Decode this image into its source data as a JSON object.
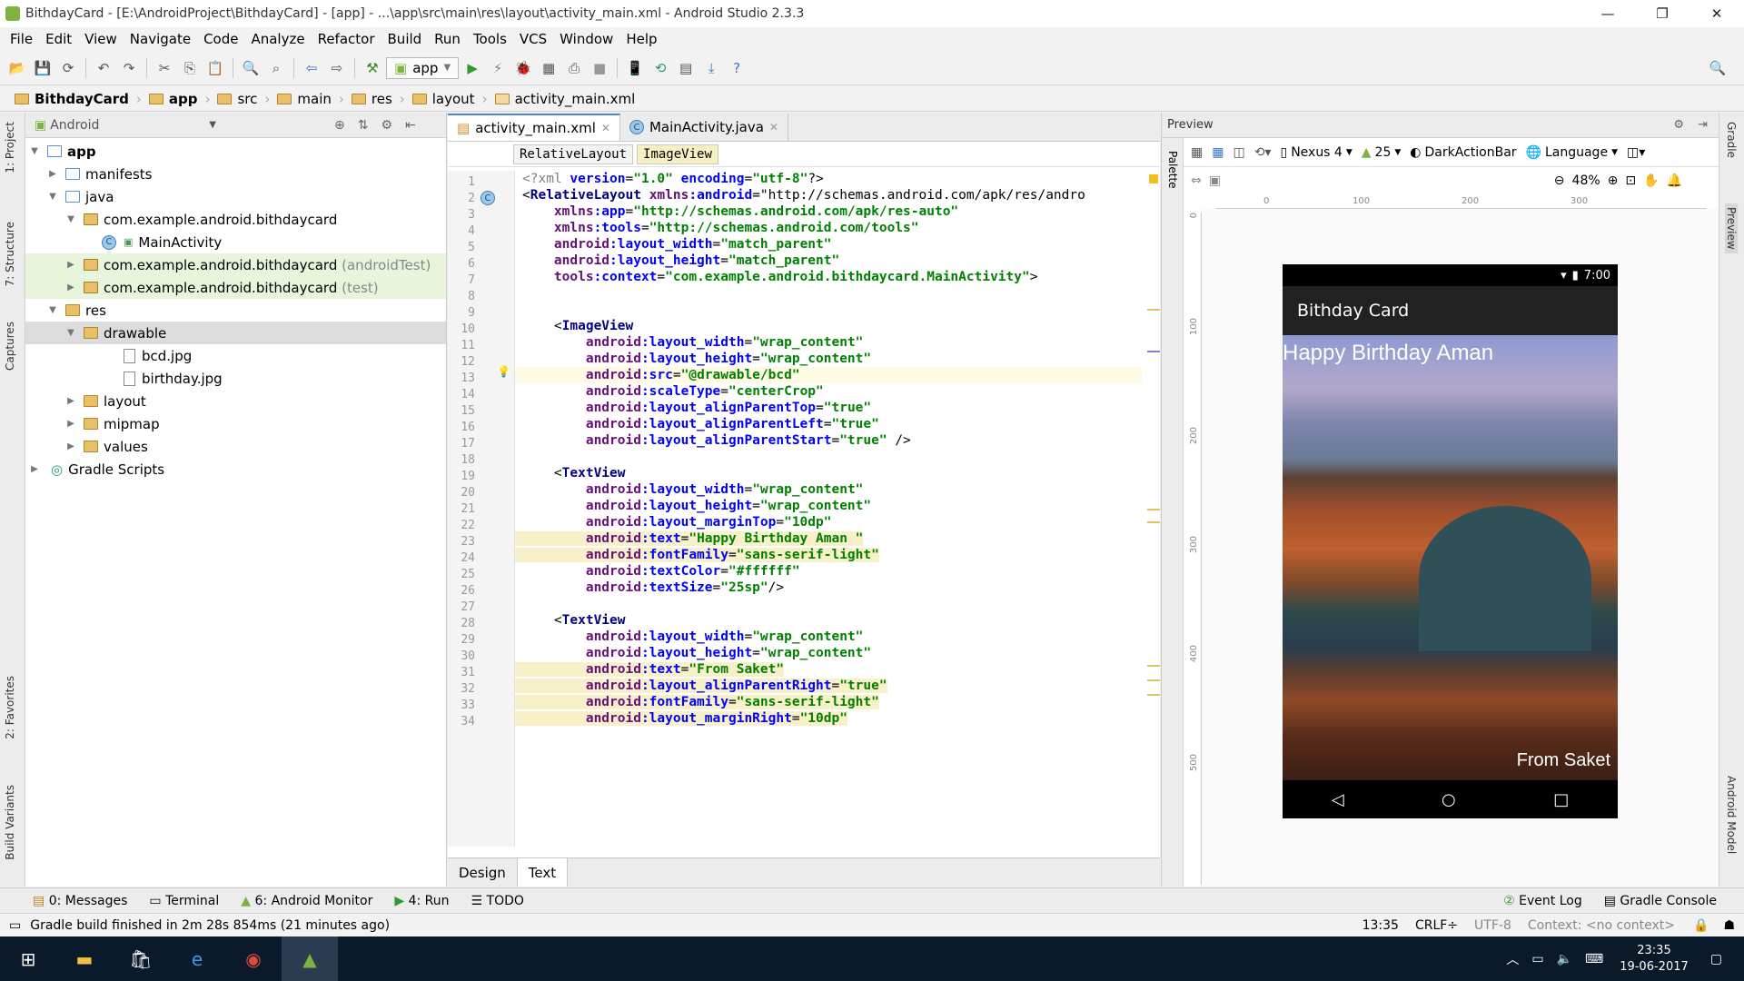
{
  "window": {
    "title": "BithdayCard - [E:\\AndroidProject\\BithdayCard] - [app] - ...\\app\\src\\main\\res\\layout\\activity_main.xml - Android Studio 2.3.3"
  },
  "menu": [
    "File",
    "Edit",
    "View",
    "Navigate",
    "Code",
    "Analyze",
    "Refactor",
    "Build",
    "Run",
    "Tools",
    "VCS",
    "Window",
    "Help"
  ],
  "toolbar": {
    "config": "app"
  },
  "breadcrumb": [
    "BithdayCard",
    "app",
    "src",
    "main",
    "res",
    "layout",
    "activity_main.xml"
  ],
  "left_tabs": [
    "1: Project",
    "7: Structure",
    "Captures",
    "2: Favorites",
    "Build Variants"
  ],
  "right_tabs": [
    "Gradle",
    "Preview",
    "Android Model"
  ],
  "project": {
    "view": "Android",
    "tree": [
      {
        "label": "app",
        "suffix": "",
        "indent": 0
      },
      {
        "label": "manifests",
        "suffix": "",
        "indent": 1
      },
      {
        "label": "java",
        "suffix": "",
        "indent": 1
      },
      {
        "label": "com.example.android.bithdaycard",
        "suffix": "",
        "indent": 2
      },
      {
        "label": "MainActivity",
        "suffix": "",
        "indent": 3
      },
      {
        "label": "com.example.android.bithdaycard",
        "suffix": "(androidTest)",
        "indent": 2
      },
      {
        "label": "com.example.android.bithdaycard",
        "suffix": "(test)",
        "indent": 2
      },
      {
        "label": "res",
        "suffix": "",
        "indent": 1
      },
      {
        "label": "drawable",
        "suffix": "",
        "indent": 2
      },
      {
        "label": "bcd.jpg",
        "suffix": "",
        "indent": 3
      },
      {
        "label": "birthday.jpg",
        "suffix": "",
        "indent": 3
      },
      {
        "label": "layout",
        "suffix": "",
        "indent": 2
      },
      {
        "label": "mipmap",
        "suffix": "",
        "indent": 2
      },
      {
        "label": "values",
        "suffix": "",
        "indent": 2
      },
      {
        "label": "Gradle Scripts",
        "suffix": "",
        "indent": 0
      }
    ]
  },
  "editor": {
    "tabs": [
      "activity_main.xml",
      "MainActivity.java"
    ],
    "crumbs": [
      "RelativeLayout",
      "ImageView"
    ],
    "lines": [
      "<?xml version=\"1.0\" encoding=\"utf-8\"?>",
      "<RelativeLayout xmlns:android=\"http://schemas.android.com/apk/res/andro",
      "    xmlns:app=\"http://schemas.android.com/apk/res-auto\"",
      "    xmlns:tools=\"http://schemas.android.com/tools\"",
      "    android:layout_width=\"match_parent\"",
      "    android:layout_height=\"match_parent\"",
      "    tools:context=\"com.example.android.bithdaycard.MainActivity\">",
      "",
      "",
      "    <ImageView",
      "        android:layout_width=\"wrap_content\"",
      "        android:layout_height=\"wrap_content\"",
      "        android:src=\"@drawable/bcd\"",
      "        android:scaleType=\"centerCrop\"",
      "        android:layout_alignParentTop=\"true\"",
      "        android:layout_alignParentLeft=\"true\"",
      "        android:layout_alignParentStart=\"true\" />",
      "",
      "    <TextView",
      "        android:layout_width=\"wrap_content\"",
      "        android:layout_height=\"wrap_content\"",
      "        android:layout_marginTop=\"10dp\"",
      "        android:text=\"Happy Birthday Aman \"",
      "        android:fontFamily=\"sans-serif-light\"",
      "        android:textColor=\"#ffffff\"",
      "        android:textSize=\"25sp\"/>",
      "",
      "    <TextView",
      "        android:layout_width=\"wrap_content\"",
      "        android:layout_height=\"wrap_content\"",
      "        android:text=\"From Saket\"",
      "        android:layout_alignParentRight=\"true\"",
      "        android:fontFamily=\"sans-serif-light\"",
      "        android:layout_marginRight=\"10dp\""
    ],
    "bottom_tabs": [
      "Design",
      "Text"
    ]
  },
  "preview": {
    "title": "Preview",
    "palette_label": "Palette",
    "device": "Nexus 4",
    "api": "25",
    "theme": "DarkActionBar",
    "language": "Language",
    "zoom": "48%",
    "ruler_h": [
      "0",
      "100",
      "200",
      "300"
    ],
    "ruler_v": [
      "0",
      "100",
      "200",
      "300",
      "400",
      "500"
    ],
    "phone": {
      "time": "7:00",
      "app_title": "Bithday Card",
      "greeting": "Happy Birthday Aman",
      "from": "From Saket"
    }
  },
  "tool_windows": [
    "0: Messages",
    "Terminal",
    "6: Android Monitor",
    "4: Run",
    "TODO",
    "Event Log",
    "Gradle Console"
  ],
  "status": {
    "message": "Gradle build finished in 2m 28s 854ms (21 minutes ago)",
    "position": "13:35",
    "line_sep": "CRLF÷",
    "encoding": "UTF-8",
    "context": "Context: <no context>"
  },
  "taskbar": {
    "time": "23:35",
    "date": "19-06-2017"
  }
}
